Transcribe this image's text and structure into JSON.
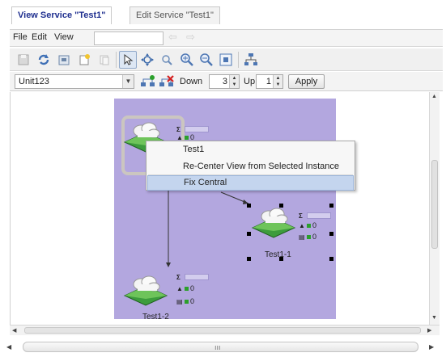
{
  "tabs": [
    {
      "label": "View Service \"Test1\"",
      "active": true
    },
    {
      "label": "Edit Service \"Test1\"",
      "active": false
    }
  ],
  "menubar": {
    "items": [
      "File",
      "Edit",
      "View"
    ],
    "search_value": ""
  },
  "toolbar": {
    "icons": [
      "save-icon",
      "refresh-icon",
      "export-icon",
      "new-instance-icon",
      "copy-icon",
      "select-pointer-icon",
      "pan-icon",
      "zoom-region-icon",
      "zoom-in-icon",
      "zoom-out-icon",
      "fit-view-icon",
      "hierarchy-icon"
    ],
    "pressed": "select-pointer-icon"
  },
  "filter": {
    "instance_value": "Unit123",
    "down_label": "Down",
    "down_value": "3",
    "up_label": "Up",
    "up_value": "1",
    "apply_label": "Apply"
  },
  "diagram": {
    "nodes": [
      {
        "name": "",
        "stat_glyphs": [
          "Σ",
          "▲",
          "▤"
        ],
        "stat_values": [
          "",
          "0",
          ""
        ]
      },
      {
        "name": "Test1-1",
        "stat_glyphs": [
          "Σ",
          "▲",
          "▤"
        ],
        "stat_values": [
          "",
          "0",
          "0"
        ]
      },
      {
        "name": "Test1-2",
        "stat_glyphs": [
          "Σ",
          "▲",
          "▤"
        ],
        "stat_values": [
          "",
          "0",
          "0"
        ]
      }
    ]
  },
  "context_menu": {
    "items": [
      {
        "label": "Test1",
        "highlighted": false
      },
      {
        "label": "Re-Center View from Selected Instance",
        "highlighted": false
      },
      {
        "label": "Fix Central",
        "highlighted": true
      }
    ]
  },
  "colors": {
    "diagram_background": "#b3a7df",
    "active_tab_text": "#1f2f8f",
    "menu_highlight": "#c4d5ee",
    "node_green": "#2ba02b"
  }
}
